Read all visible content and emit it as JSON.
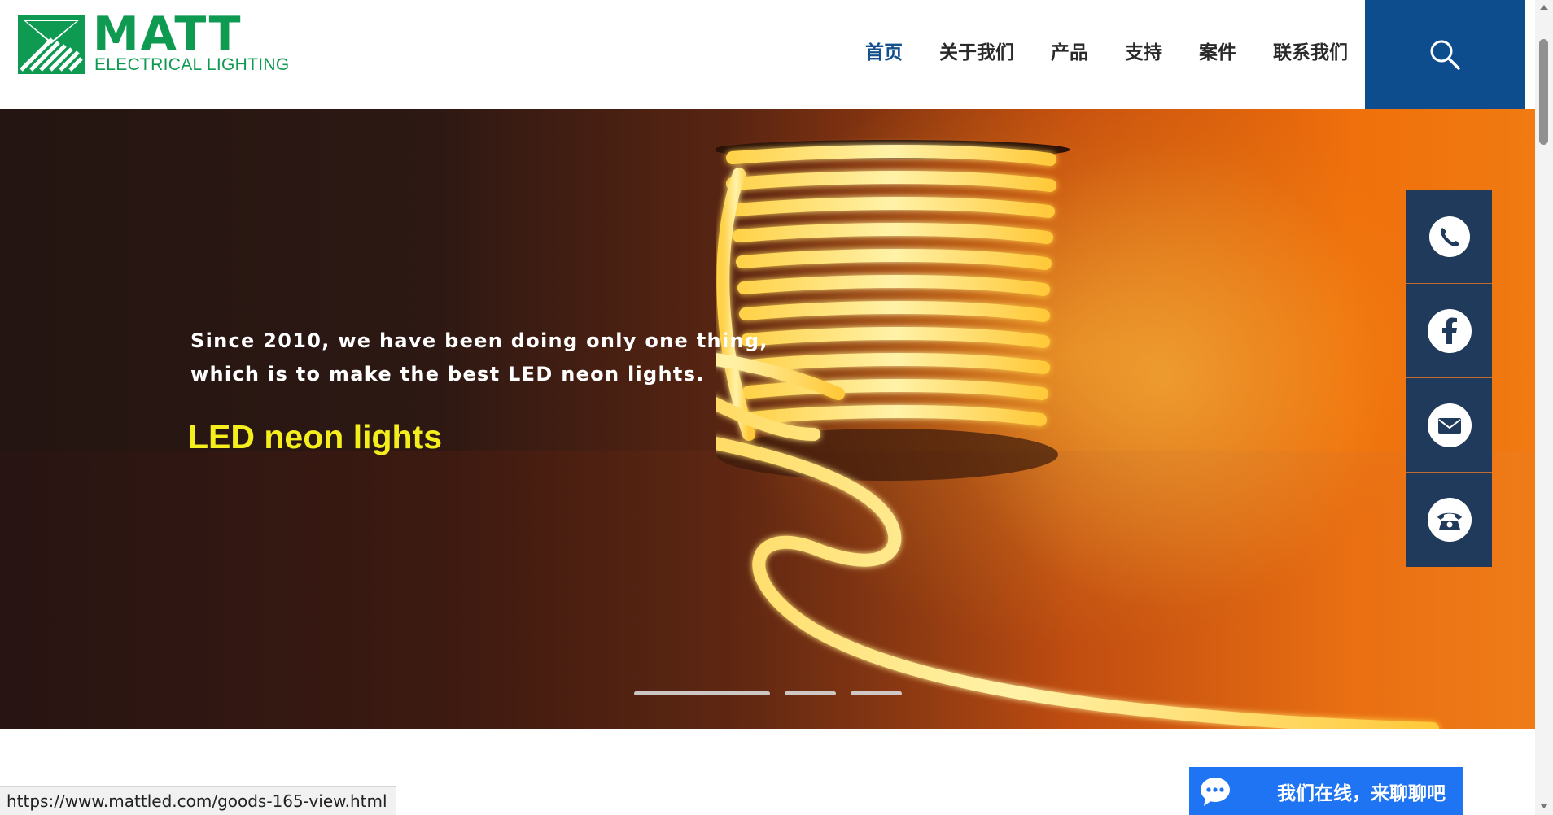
{
  "header": {
    "logo": {
      "name": "MATT",
      "subtitle": "ELECTRICAL LIGHTING",
      "brand_color": "#0f9a52"
    },
    "nav": [
      {
        "label": "首页",
        "active": true
      },
      {
        "label": "关于我们",
        "active": false
      },
      {
        "label": "产品",
        "active": false
      },
      {
        "label": "支持",
        "active": false
      },
      {
        "label": "案件",
        "active": false
      },
      {
        "label": "联系我们",
        "active": false
      }
    ],
    "search_icon": "search-icon",
    "accent_color": "#0d4d8e"
  },
  "hero": {
    "line1": "Since 2010, we have been doing only one thing,",
    "line2": "which is to make the best LED neon lights.",
    "title": "LED neon lights",
    "title_color": "#f4ee1c",
    "slides": 3,
    "active_slide": 1
  },
  "side_panel": {
    "icons": [
      "whatsapp-icon",
      "facebook-icon",
      "email-icon",
      "phone-icon"
    ],
    "color": "#1f3a5a"
  },
  "status_bar": {
    "url": "https://www.mattled.com/goods-165-view.html"
  },
  "chat": {
    "label": "我们在线，来聊聊吧",
    "icon": "chat-bubble-icon",
    "color": "#1e74f2"
  }
}
